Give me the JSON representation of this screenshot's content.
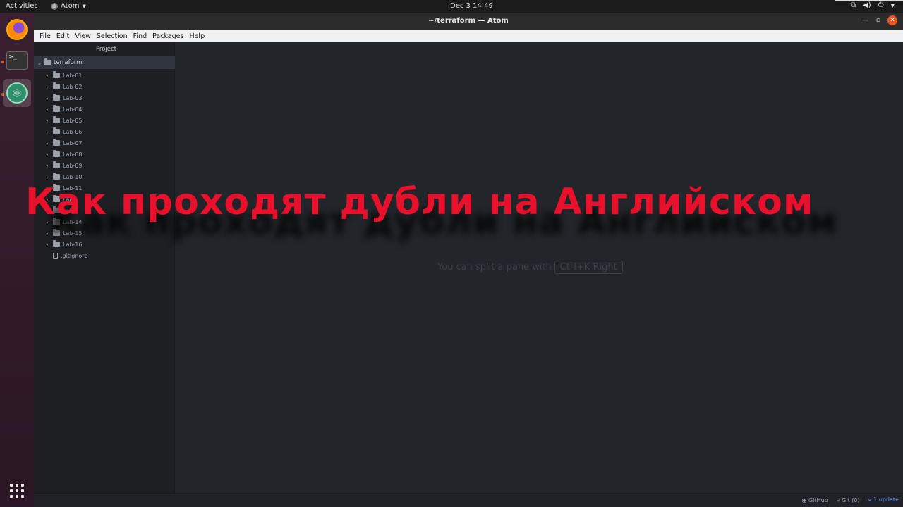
{
  "topbar": {
    "activities": "Activities",
    "app_name": "Atom",
    "clock": "Dec 3  14:49"
  },
  "dock": {
    "items": [
      {
        "name": "Firefox",
        "icon": "firefox-icon"
      },
      {
        "name": "Terminal",
        "icon": "terminal-icon"
      },
      {
        "name": "Atom",
        "icon": "atom-icon"
      }
    ]
  },
  "window": {
    "title": "~/terraform — Atom"
  },
  "menubar": {
    "items": [
      "File",
      "Edit",
      "View",
      "Selection",
      "Find",
      "Packages",
      "Help"
    ]
  },
  "tree": {
    "header": "Project",
    "root": "terraform",
    "folders": [
      "Lab-01",
      "Lab-02",
      "Lab-03",
      "Lab-04",
      "Lab-05",
      "Lab-06",
      "Lab-07",
      "Lab-08",
      "Lab-09",
      "Lab-10",
      "Lab-11",
      "Lab-",
      "Lab-",
      "Lab-14",
      "Lab-15",
      "Lab-16"
    ],
    "files": [
      ".gitignore"
    ]
  },
  "editor": {
    "hint_text": "You can split a pane with",
    "hint_key": "Ctrl+K Right"
  },
  "statusbar": {
    "github": "GitHub",
    "git": "Git (0)",
    "update": "1 update"
  },
  "overlay": {
    "caption": "Как проходят дубли на Английском",
    "color": "#e8102a"
  }
}
